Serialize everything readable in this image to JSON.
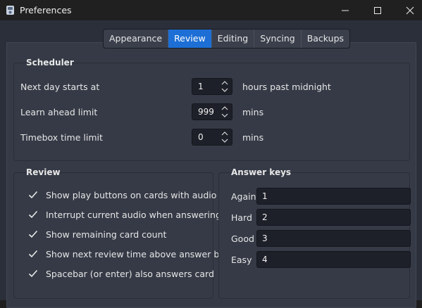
{
  "window": {
    "title": "Preferences"
  },
  "tabs": [
    {
      "label": "Appearance",
      "active": false
    },
    {
      "label": "Review",
      "active": true
    },
    {
      "label": "Editing",
      "active": false
    },
    {
      "label": "Syncing",
      "active": false
    },
    {
      "label": "Backups",
      "active": false
    }
  ],
  "scheduler": {
    "title": "Scheduler",
    "next_day": {
      "label": "Next day starts at",
      "value": "1",
      "unit": "hours past midnight"
    },
    "learn_ahead": {
      "label": "Learn ahead limit",
      "value": "999",
      "unit": "mins"
    },
    "timebox": {
      "label": "Timebox time limit",
      "value": "0",
      "unit": "mins"
    }
  },
  "review": {
    "title": "Review",
    "options": [
      {
        "label": "Show play buttons on cards with audio",
        "checked": true
      },
      {
        "label": "Interrupt current audio when answering",
        "checked": true
      },
      {
        "label": "Show remaining card count",
        "checked": true
      },
      {
        "label": "Show next review time above answer buttons",
        "checked": true
      },
      {
        "label": "Spacebar (or enter) also answers card",
        "checked": true
      }
    ]
  },
  "answer_keys": {
    "title": "Answer keys",
    "keys": [
      {
        "label": "Again",
        "value": "1"
      },
      {
        "label": "Hard",
        "value": "2"
      },
      {
        "label": "Good",
        "value": "3"
      },
      {
        "label": "Easy",
        "value": "4"
      }
    ]
  },
  "colors": {
    "accent": "#1d6fd6",
    "window_bg": "#2b2f3a",
    "panel_bg": "#353a46",
    "input_bg": "#1e2029"
  }
}
